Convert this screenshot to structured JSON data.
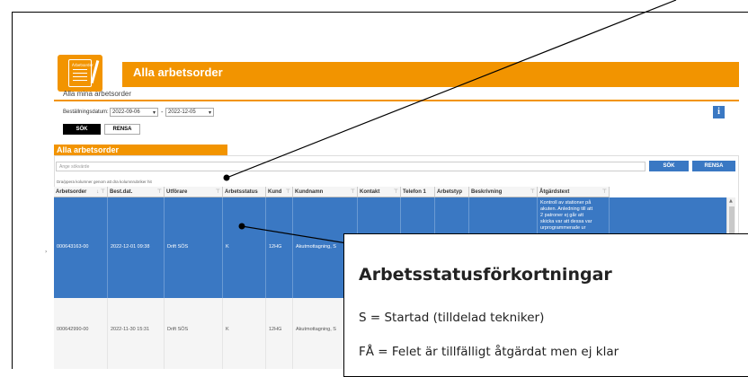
{
  "header": {
    "title": "Alla arbetsorder",
    "subtitle": "Alla mina arbetsorder",
    "logo_text": "Arbetsorder"
  },
  "filter": {
    "label": "Beställningsdatum:",
    "from": "2022-09-06",
    "to": "2022-12-05",
    "dash": "-",
    "search_button": "SÖK",
    "clear_button": "RENSA"
  },
  "info_icon": "i",
  "section": {
    "title": "Alla arbetsorder",
    "search_placeholder": "Ange sökvärde",
    "search_button": "SÖK",
    "clear_button": "RENSA",
    "group_hint": "Dra/ppera kolumner genom att dra kolumnrubriker hit"
  },
  "grid": {
    "columns": [
      "Arbetsorder",
      "Best.dat.",
      "Utförare",
      "Arbetsstatus",
      "Kund",
      "Kundnamn",
      "Kontakt",
      "Telefon 1",
      "Arbetstyp",
      "Beskrivning",
      "Åtgärdstext"
    ],
    "sort_indicator": "↓",
    "filter_icon": "⊤",
    "row_marker": "›",
    "rows": [
      {
        "arbetsorder": "000643163-00",
        "best_dat": "2022-12-01 09:38",
        "utforare": "Drift SÖS",
        "arbetsstatus": "K",
        "kund": "12HG",
        "kundnamn": "Akutmottagning, S",
        "atgardstext": [
          "Kontroll av stationer på",
          "akuten. Anledning till att",
          "2 patroner ej går att",
          "skicka var att dessa var",
          "urprogrammerade ur"
        ]
      },
      {
        "arbetsorder": "000642990-00",
        "best_dat": "2022-11-30 15:31",
        "utforare": "Drift SÖS",
        "arbetsstatus": "K",
        "kund": "12HG",
        "kundnamn": "Akutmottagning, S"
      }
    ]
  },
  "callout": {
    "title": "Arbetsstatusförkortningar",
    "lines": [
      "S   = Startad (tilldelad tekniker)",
      "FÅ  = Felet är tillfälligt åtgärdat men ej klar"
    ]
  },
  "colors": {
    "accent": "#f29400",
    "blue": "#3a78c3",
    "selected_row": "#3a78c3"
  }
}
